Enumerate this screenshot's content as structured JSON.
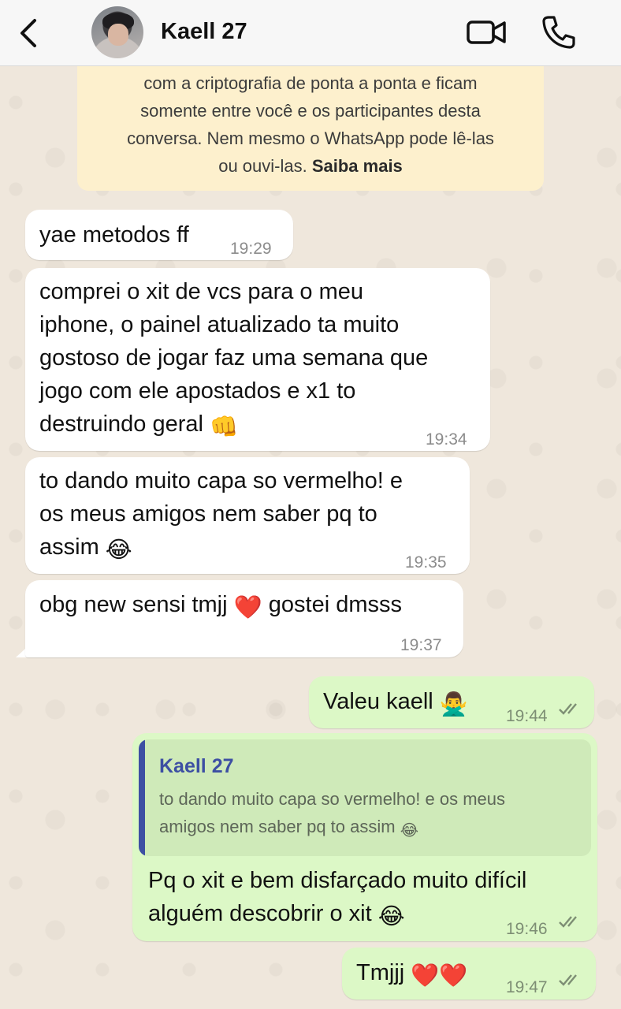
{
  "header": {
    "contact_name": "Kaell 27",
    "back_icon": "chevron-left-icon",
    "video_icon": "video-camera-icon",
    "call_icon": "phone-icon"
  },
  "notice": {
    "line1": "com a criptografia de ponta a ponta e ficam",
    "line2": "somente entre você e os participantes desta",
    "line3": "conversa. Nem mesmo o WhatsApp pode lê-las",
    "line4_prefix": "ou ouvi-las.",
    "link": "Saiba mais"
  },
  "messages": [
    {
      "direction": "in",
      "lines": [
        "yae metodos ff"
      ],
      "time": "19:29"
    },
    {
      "direction": "in",
      "lines": [
        "comprei o xit de vcs para o meu",
        "iphone, o painel atualizado ta muito",
        "gostoso de jogar faz uma semana que",
        "jogo com ele apostados e x1 to",
        "destruindo geral"
      ],
      "emoji": "👊",
      "time": "19:34"
    },
    {
      "direction": "in",
      "lines": [
        "to dando muito capa so vermelho! e",
        "os meus amigos nem saber pq to",
        "assim"
      ],
      "emoji": "😂",
      "time": "19:35"
    },
    {
      "direction": "in",
      "lines": [
        "obg new sensi tmjj",
        "gostei dmsss"
      ],
      "emoji": "❤️",
      "time": "19:37"
    },
    {
      "direction": "out",
      "lines": [
        "Valeu kaell"
      ],
      "emoji": "🙅‍♂️",
      "time": "19:44"
    },
    {
      "direction": "out",
      "reply_to": {
        "author": "Kaell 27",
        "line1": "to dando muito capa so vermelho! e os meus",
        "line2": "amigos nem saber pq to assim",
        "emoji": "😂"
      },
      "lines": [
        "Pq o xit e bem disfarçado muito difícil",
        "alguém descobrir o xit"
      ],
      "emoji": "😂",
      "time": "19:46"
    },
    {
      "direction": "out",
      "lines": [
        "Tmjjj"
      ],
      "emoji": "❤️❤️",
      "time": "19:47"
    }
  ],
  "colors": {
    "incoming": "#ffffff",
    "outgoing": "#dcf8c6",
    "notice": "#fdf0cd",
    "quote_accent": "#3d4fa3"
  }
}
